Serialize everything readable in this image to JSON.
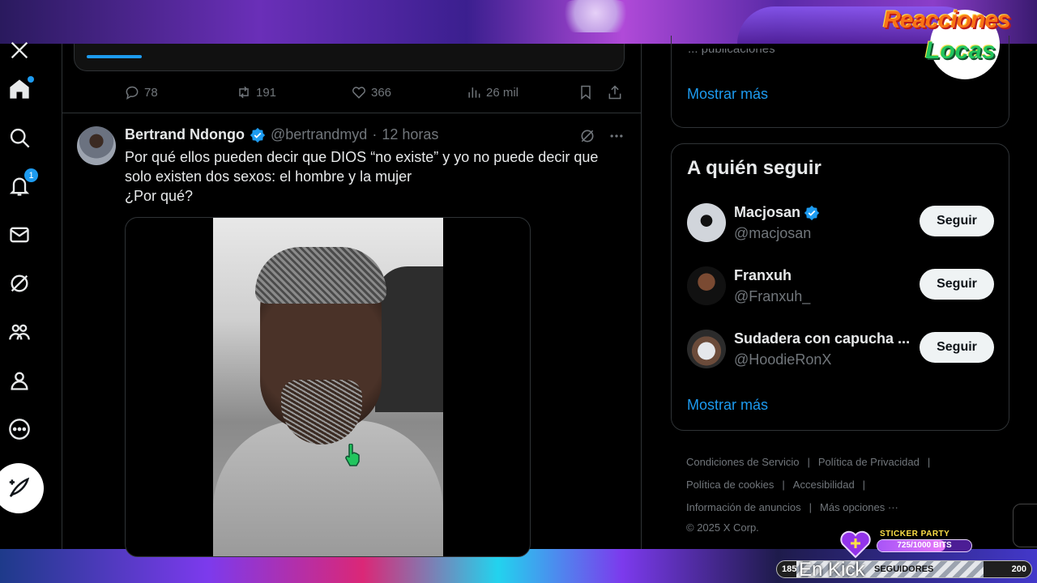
{
  "app": {
    "name": "X"
  },
  "overlay": {
    "logo_line1": "Reacciones",
    "logo_line2": "Locas"
  },
  "nav": {
    "items": [
      {
        "name": "home",
        "icon": "home-icon"
      },
      {
        "name": "explore",
        "icon": "search-icon"
      },
      {
        "name": "notifications",
        "icon": "bell-icon",
        "badge": "1"
      },
      {
        "name": "messages",
        "icon": "mail-icon"
      },
      {
        "name": "grok",
        "icon": "grok-icon"
      },
      {
        "name": "communities",
        "icon": "people-icon"
      },
      {
        "name": "profile",
        "icon": "person-icon"
      },
      {
        "name": "more",
        "icon": "more-circle-icon"
      }
    ],
    "post_icon": "compose-icon"
  },
  "prev_post": {
    "replies": "78",
    "reposts": "191",
    "likes": "366",
    "views": "26 mil"
  },
  "tweet": {
    "name": "Bertrand Ndongo",
    "handle": "@bertrandmyd",
    "separator": "·",
    "time": "12 horas",
    "text_line1": "Por qué ellos pueden decir que DIOS “no existe” y yo no puede decir que",
    "text_line2": "solo existen dos sexos: el hombre y la mujer",
    "text_line3": "¿Por qué?"
  },
  "sidebar": {
    "top_card": {
      "faded_text": "...  publicaciones",
      "show_more": "Mostrar más"
    },
    "who_to_follow": {
      "title": "A quién seguir",
      "suggestions": [
        {
          "name": "Macjosan",
          "handle": "@macjosan",
          "verified": true,
          "button": "Seguir"
        },
        {
          "name": "Franxuh",
          "handle": "@Franxuh_",
          "verified": false,
          "button": "Seguir"
        },
        {
          "name": "Sudadera con capucha ...",
          "handle": "@HoodieRonX",
          "verified": false,
          "button": "Seguir"
        }
      ],
      "show_more": "Mostrar más"
    },
    "footer": {
      "terms": "Condiciones de Servicio",
      "privacy": "Política de Privacidad",
      "cookies": "Política de cookies",
      "accessibility": "Accesibilidad",
      "ads": "Información de anuncios",
      "more": "Más opciones ···",
      "copyright": "© 2025 X Corp.",
      "divider": "|"
    }
  },
  "stream": {
    "sticker_label": "STICKER PARTY",
    "bits_text": "725/1000 BITS",
    "bits_progress": 0.725,
    "followers_current": "185",
    "followers_label": "SEGUIDORES",
    "followers_goal": "200",
    "followers_progress": 0.925,
    "kick_text": "En Kick"
  },
  "colors": {
    "accent": "#1d9bf0",
    "background": "#000000",
    "border": "#2f3336",
    "muted": "#71767b"
  }
}
